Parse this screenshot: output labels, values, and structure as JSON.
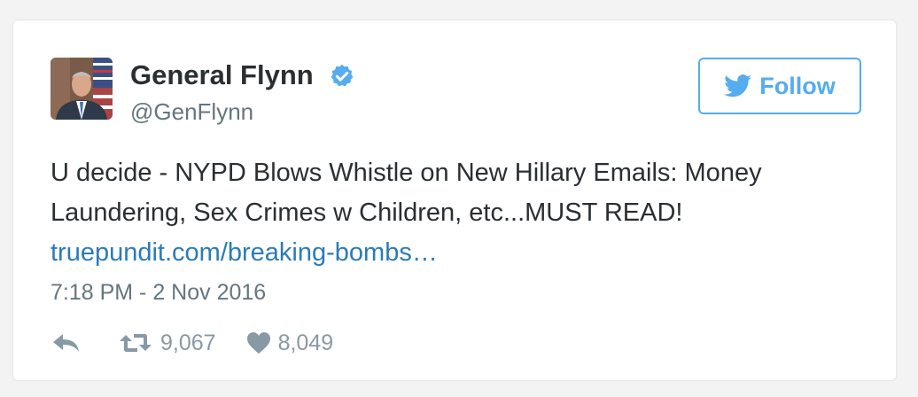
{
  "tweet": {
    "author": {
      "name": "General Flynn",
      "handle": "@GenFlynn",
      "verified": true
    },
    "follow_button": {
      "label": "Follow",
      "icon": "twitter-bird-icon"
    },
    "text_lines": [
      "U decide - NYPD Blows Whistle on New Hillary Emails: Money",
      "Laundering, Sex Crimes w Children, etc...MUST READ!"
    ],
    "link": "truepundit.com/breaking-bombs…",
    "timestamp": "7:18 PM - 2 Nov 2016",
    "actions": {
      "reply": {
        "icon": "reply-icon"
      },
      "retweet": {
        "icon": "retweet-icon",
        "count": "9,067"
      },
      "like": {
        "icon": "heart-icon",
        "count": "8,049"
      }
    }
  },
  "colors": {
    "accent": "#55acee",
    "link": "#2b7bb9",
    "text": "#292f33",
    "muted": "#66757f",
    "action_gray": "#8899a6",
    "background": "#f3f3f3",
    "card": "#ffffff",
    "border": "#e1e8ed"
  }
}
